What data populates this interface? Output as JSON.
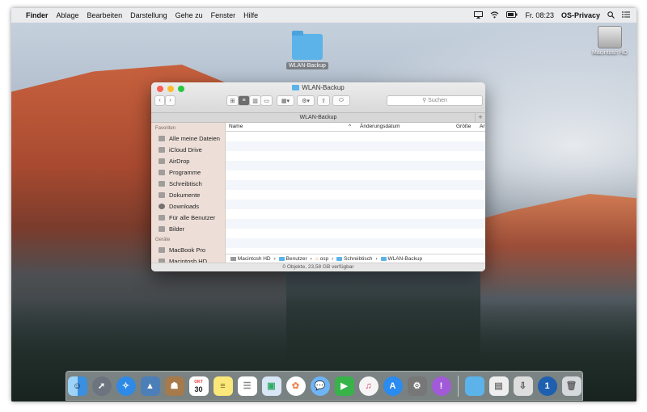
{
  "menubar": {
    "apple": "",
    "items": [
      "Finder",
      "Ablage",
      "Bearbeiten",
      "Darstellung",
      "Gehe zu",
      "Fenster",
      "Hilfe"
    ],
    "clock": "Fr. 08:23",
    "user": "OS-Privacy"
  },
  "desktop": {
    "folder_label": "WLAN-Backup",
    "hd_label": "Macintosh HD"
  },
  "window": {
    "title": "WLAN-Backup",
    "search_placeholder": "Suchen",
    "path_tab": "WLAN-Backup",
    "plus": "+",
    "columns": {
      "name": "Name",
      "date": "Änderungsdatum",
      "size": "Größe",
      "kind": "Ar"
    },
    "sidebar": {
      "favorites_header": "Favoriten",
      "favorites": [
        "Alle meine Dateien",
        "iCloud Drive",
        "AirDrop",
        "Programme",
        "Schreibtisch",
        "Dokumente",
        "Downloads",
        "Für alle Benutzer",
        "Bilder"
      ],
      "devices_header": "Geräte",
      "devices": [
        "MacBook Pro",
        "Macintosh HD"
      ]
    },
    "pathbar": [
      "Macintosh HD",
      "Benutzer",
      "osp",
      "Schreibtisch",
      "WLAN-Backup"
    ],
    "status": "0 Objekte, 23,58 GB verfügbar"
  },
  "dock": {
    "calendar_month": "OKT",
    "calendar_day": "30"
  },
  "colors": {
    "folder": "#5bb3ea",
    "close": "#fc5f57",
    "minimize": "#fdbc2e",
    "zoom": "#28c840"
  }
}
